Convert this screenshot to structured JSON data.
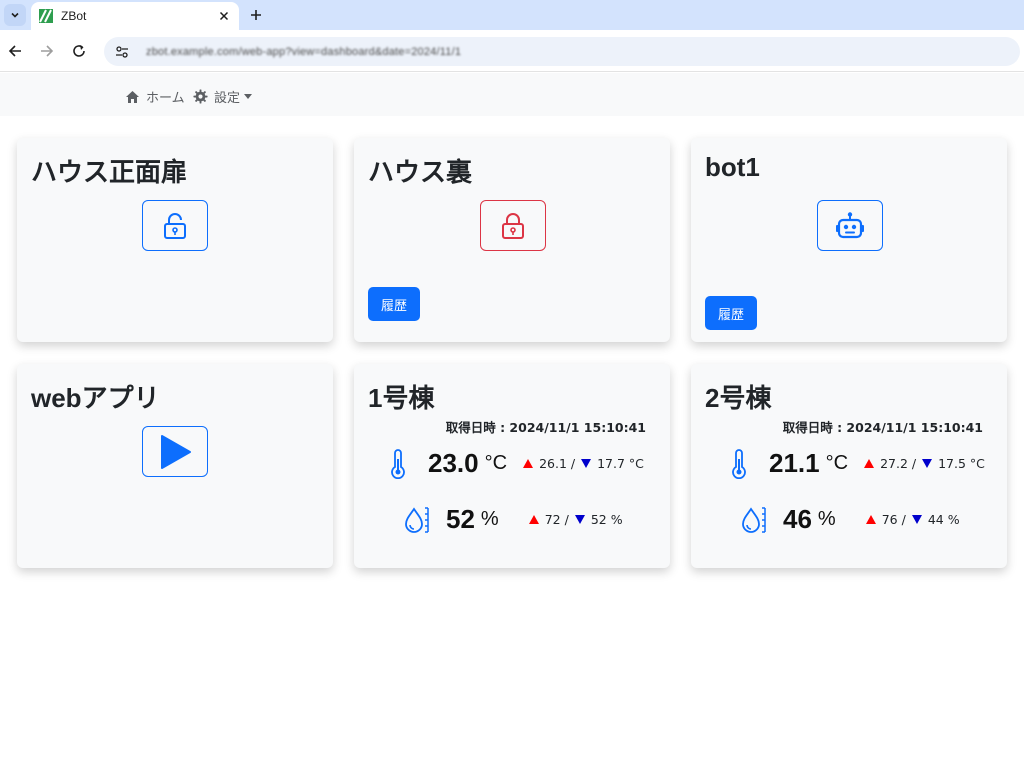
{
  "browser": {
    "tab_title": "ZBot",
    "url": "zbot.example.com/web-app?view=dashboard&date=2024/11/1"
  },
  "appnav": {
    "home_label": "ホーム",
    "settings_label": "設定"
  },
  "cards": {
    "front_door": {
      "title": "ハウス正面扉",
      "state": "unlocked"
    },
    "back": {
      "title": "ハウス裏",
      "state": "locked",
      "history_label": "履歴"
    },
    "bot1": {
      "title": "bot1",
      "history_label": "履歴"
    },
    "webapp": {
      "title": "webアプリ"
    },
    "bldg1": {
      "title": "1号棟",
      "acquired_label": "取得日時 : 2024/11/1 15:10:41",
      "temp_value": "23.0",
      "temp_unit": "°C",
      "temp_max": "26.1 /",
      "temp_min": "17.7 °C",
      "hum_value": "52",
      "hum_unit": "%",
      "hum_max": "72 /",
      "hum_min": "52 %"
    },
    "bldg2": {
      "title": "2号棟",
      "acquired_label": "取得日時 : 2024/11/1 15:10:41",
      "temp_value": "21.1",
      "temp_unit": "°C",
      "temp_max": "27.2 /",
      "temp_min": "17.5 °C",
      "hum_value": "46",
      "hum_unit": "%",
      "hum_max": "76 /",
      "hum_min": "44 %"
    }
  },
  "colors": {
    "primary": "#0d6efd",
    "danger": "#dc3545",
    "max_arrow": "#ff0000",
    "min_arrow": "#0000cc"
  }
}
